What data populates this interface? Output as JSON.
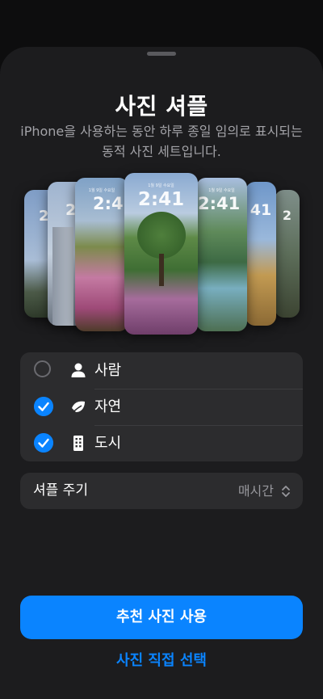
{
  "sheet": {
    "title": "사진 셔플",
    "subtitle": "iPhone을 사용하는 동안 하루 종일 임의로 표시되는 동적 사진 세트입니다."
  },
  "preview": {
    "time": "2:41",
    "date": "1월 9일 수요일",
    "time_partial_left": "2",
    "time_partial_right": "41"
  },
  "categories": [
    {
      "label": "사람",
      "selected": false,
      "icon": "person-icon"
    },
    {
      "label": "자연",
      "selected": true,
      "icon": "leaf-icon"
    },
    {
      "label": "도시",
      "selected": true,
      "icon": "building-icon"
    }
  ],
  "shuffle_frequency": {
    "label": "셔플 주기",
    "value": "매시간",
    "icon": "up-down-chevron-icon"
  },
  "buttons": {
    "primary": "추천 사진 사용",
    "secondary": "사진 직접 선택"
  },
  "colors": {
    "accent": "#0a84ff",
    "sheet_bg": "#1c1c1e",
    "group_bg": "#2c2c2e"
  }
}
